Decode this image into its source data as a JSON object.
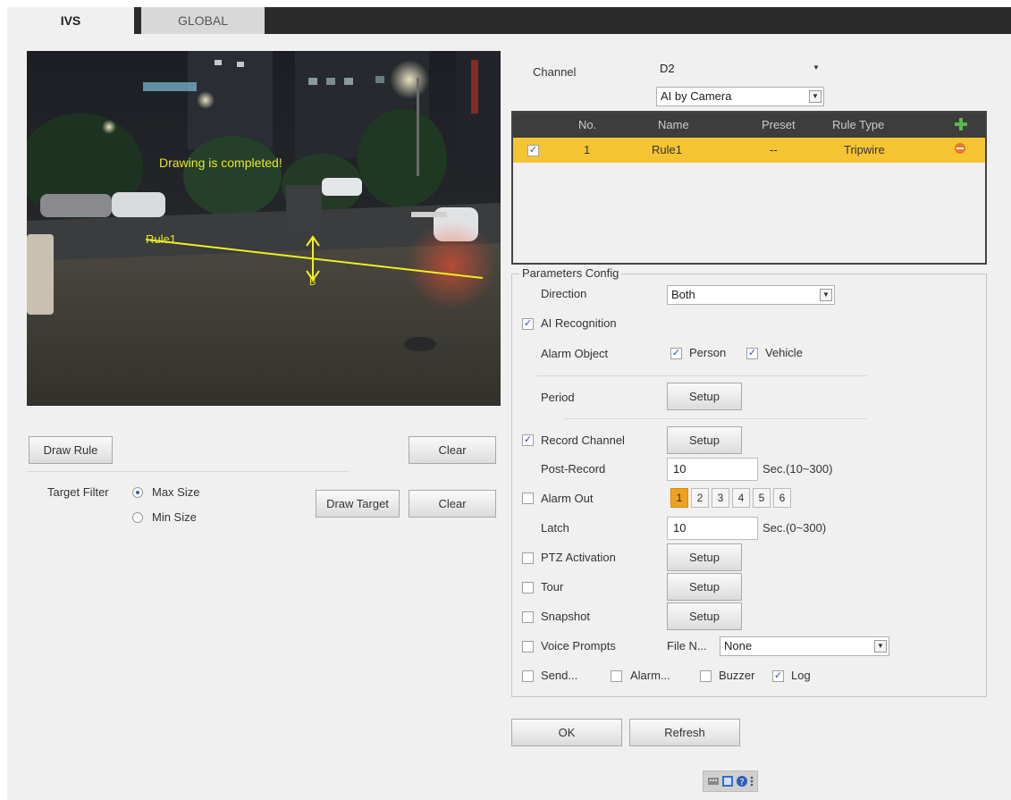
{
  "tabs": [
    {
      "label": "IVS",
      "active": true
    },
    {
      "label": "GLOBAL",
      "active": false
    }
  ],
  "video": {
    "overlay_text": "Drawing is completed!",
    "rule_label": "Rule1",
    "direction_label": "B",
    "overlay_color": "#e8e820"
  },
  "left_panel": {
    "draw_rule_label": "Draw Rule",
    "clear_label": "Clear",
    "target_filter_label": "Target Filter",
    "max_size_label": "Max Size",
    "min_size_label": "Min Size",
    "draw_target_label": "Draw Target",
    "clear2_label": "Clear"
  },
  "channel": {
    "label": "Channel",
    "value": "D2",
    "mode_value": "AI by Camera"
  },
  "rule_table": {
    "headers": {
      "no": "No.",
      "name": "Name",
      "preset": "Preset",
      "rule_type": "Rule Type"
    },
    "rows": [
      {
        "checked": true,
        "no": "1",
        "name": "Rule1",
        "preset": "--",
        "rule_type": "Tripwire"
      }
    ],
    "highlight_color": "#f5c433"
  },
  "params": {
    "title": "Parameters Config",
    "direction_label": "Direction",
    "direction_value": "Both",
    "ai_recognition_label": "AI Recognition",
    "ai_recognition_checked": true,
    "alarm_object_label": "Alarm Object",
    "person_label": "Person",
    "vehicle_label": "Vehicle",
    "period_label": "Period",
    "setup_label": "Setup",
    "record_channel_label": "Record Channel",
    "post_record_label": "Post-Record",
    "post_record_value": "10",
    "post_record_unit": "Sec.(10~300)",
    "alarm_out_label": "Alarm Out",
    "alarm_out_numbers": [
      "1",
      "2",
      "3",
      "4",
      "5",
      "6"
    ],
    "latch_label": "Latch",
    "latch_value": "10",
    "latch_unit": "Sec.(0~300)",
    "ptz_label": "PTZ Activation",
    "tour_label": "Tour",
    "snapshot_label": "Snapshot",
    "voice_prompts_label": "Voice Prompts",
    "file_name_label": "File N...",
    "file_name_value": "None",
    "send_label": "Send...",
    "alarm_label": "Alarm...",
    "buzzer_label": "Buzzer",
    "log_label": "Log"
  },
  "footer": {
    "ok_label": "OK",
    "refresh_label": "Refresh"
  }
}
